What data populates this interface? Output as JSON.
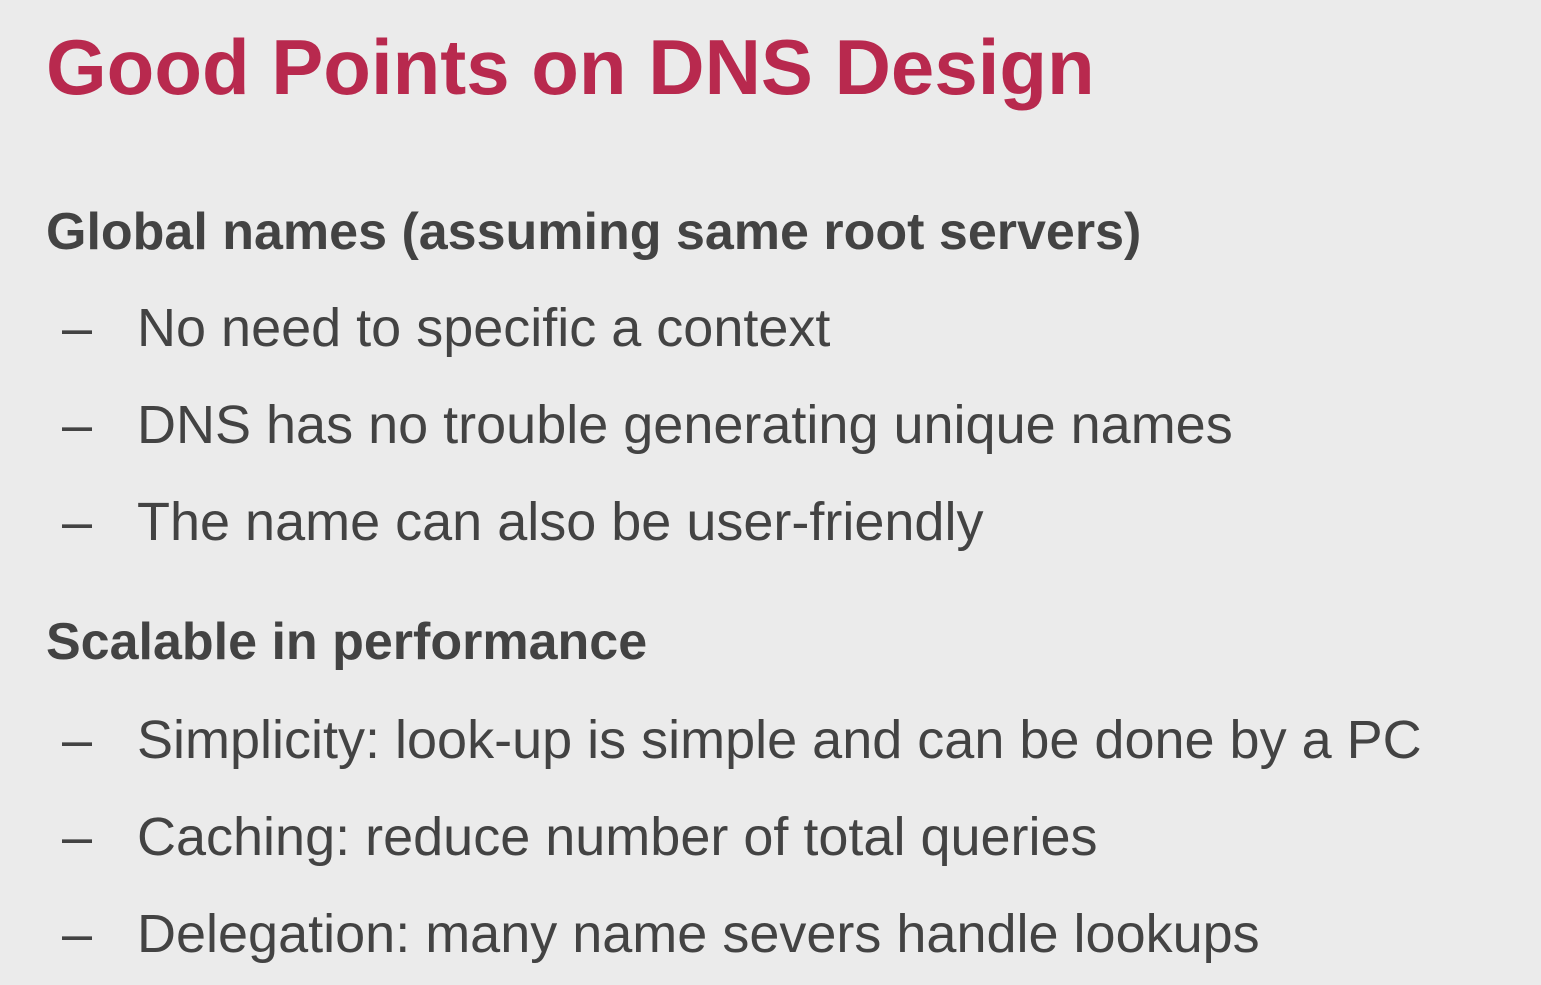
{
  "slide": {
    "title": "Good Points on DNS Design",
    "sections": [
      {
        "heading": "Global names (assuming same root servers)",
        "bullets": [
          "No need to specific a context",
          "DNS has no trouble generating unique names",
          "The name can also be user-friendly"
        ]
      },
      {
        "heading": "Scalable in performance",
        "bullets": [
          "Simplicity: look-up is simple and can be done by a PC",
          "Caching: reduce number of total queries",
          "Delegation: many name severs handle lookups"
        ]
      }
    ],
    "bullet_marker": "–",
    "colors": {
      "background": "#ebebeb",
      "title": "#b8294e",
      "text": "#434343"
    }
  }
}
